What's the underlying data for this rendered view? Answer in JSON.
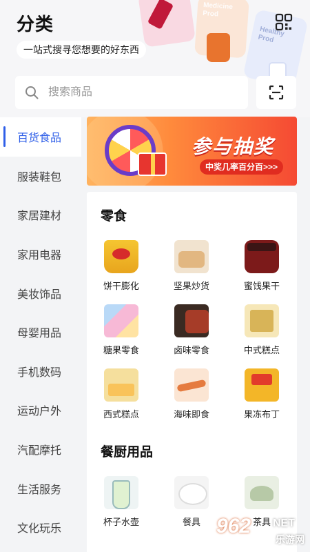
{
  "header": {
    "title": "分类",
    "subtitle": "一站式搜寻您想要的好东西",
    "decor_labels": [
      "Medicine",
      "Prod",
      "Healthy",
      "Prod"
    ]
  },
  "search": {
    "placeholder": "搜索商品",
    "value": ""
  },
  "sidebar": {
    "items": [
      {
        "label": "百货食品",
        "active": true
      },
      {
        "label": "服装鞋包",
        "active": false
      },
      {
        "label": "家居建材",
        "active": false
      },
      {
        "label": "家用电器",
        "active": false
      },
      {
        "label": "美妆饰品",
        "active": false
      },
      {
        "label": "母婴用品",
        "active": false
      },
      {
        "label": "手机数码",
        "active": false
      },
      {
        "label": "运动户外",
        "active": false
      },
      {
        "label": "汽配摩托",
        "active": false
      },
      {
        "label": "生活服务",
        "active": false
      },
      {
        "label": "文化玩乐",
        "active": false
      }
    ],
    "active_color": "#2f5fe8"
  },
  "banner": {
    "title": "参与抽奖",
    "subtitle": "中奖几率百分百>>>"
  },
  "sections": [
    {
      "title": "零食",
      "items": [
        {
          "label": "饼干膨化",
          "icon": "chips-bag-icon"
        },
        {
          "label": "坚果炒货",
          "icon": "nuts-box-icon"
        },
        {
          "label": "蜜饯果干",
          "icon": "dried-fruit-jar-icon"
        },
        {
          "label": "糖果零食",
          "icon": "candy-pack-icon"
        },
        {
          "label": "卤味零食",
          "icon": "braised-snack-icon"
        },
        {
          "label": "中式糕点",
          "icon": "chinese-pastry-box-icon"
        },
        {
          "label": "西式糕点",
          "icon": "western-cake-box-icon"
        },
        {
          "label": "海味即食",
          "icon": "seafood-snack-icon"
        },
        {
          "label": "果冻布丁",
          "icon": "jelly-pudding-bag-icon"
        }
      ]
    },
    {
      "title": "餐厨用品",
      "items": [
        {
          "label": "杯子水壶",
          "icon": "pitcher-icon"
        },
        {
          "label": "餐具",
          "icon": "plates-icon"
        },
        {
          "label": "茶具",
          "icon": "tea-set-icon"
        }
      ]
    }
  ],
  "watermark": {
    "mark": "962",
    "net": "NET",
    "sub": "乐游网"
  }
}
